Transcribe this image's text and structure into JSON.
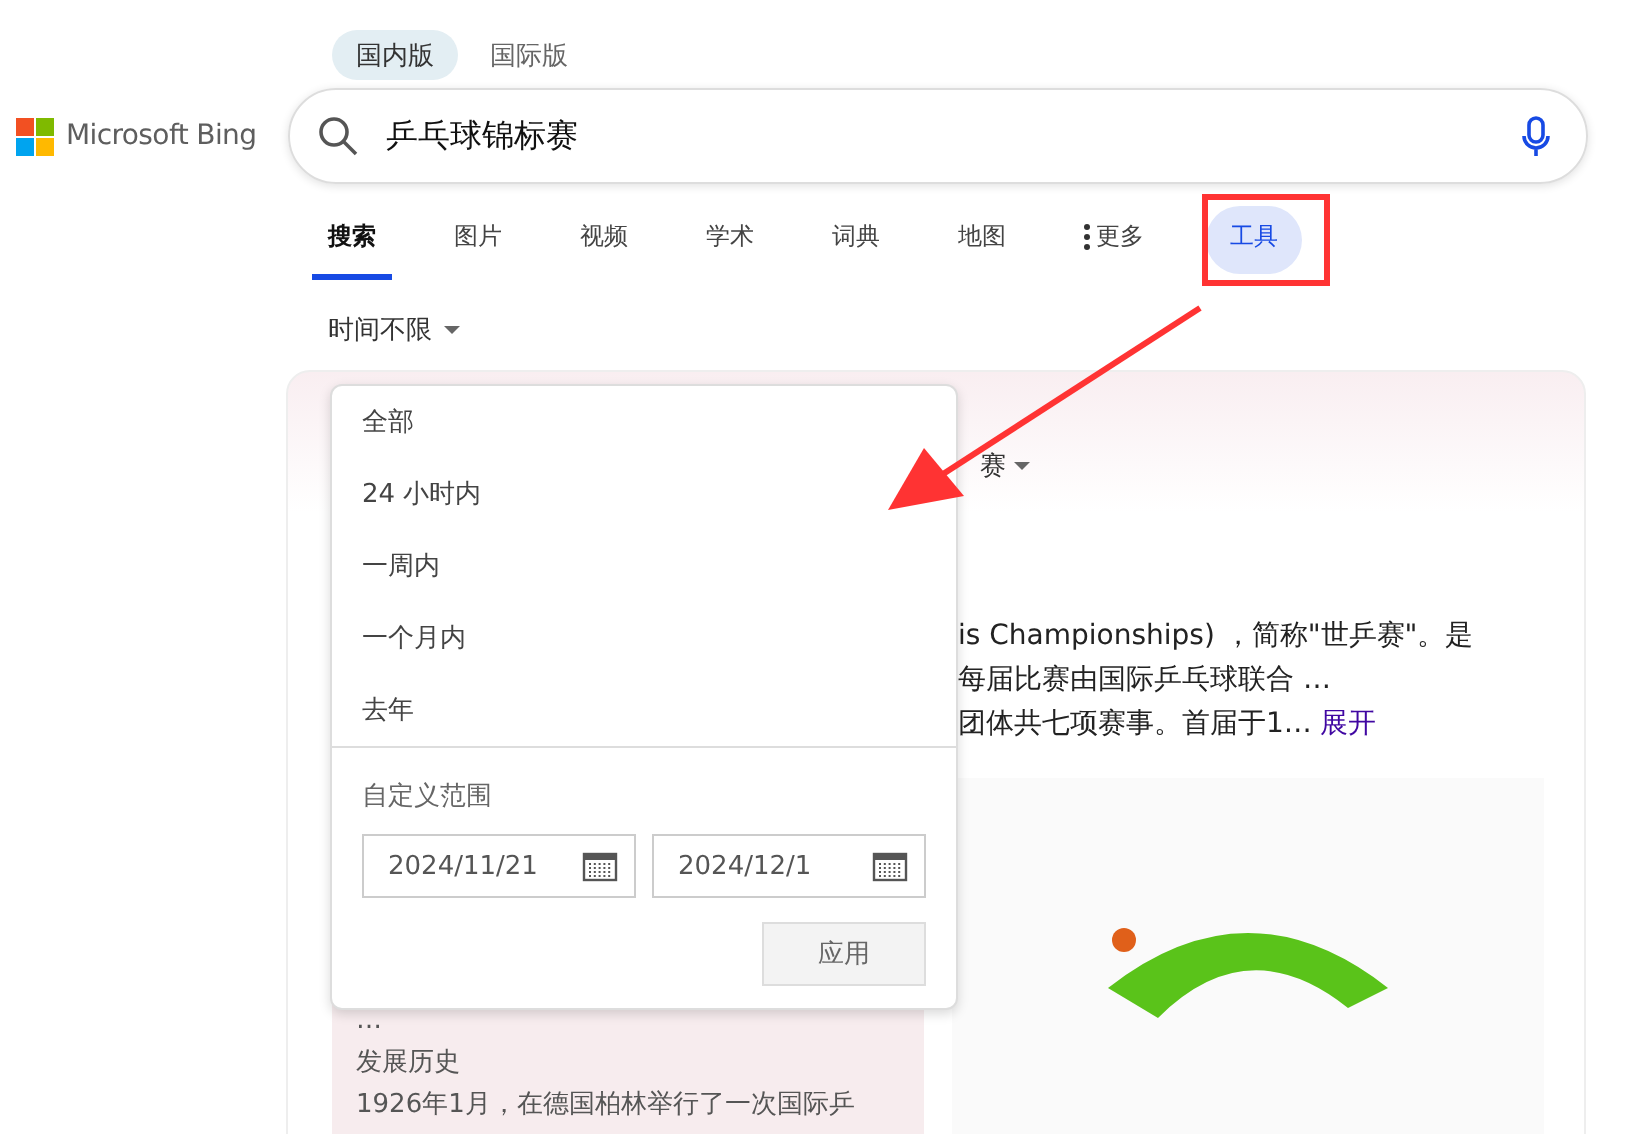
{
  "region_tabs": [
    {
      "label": "国内版",
      "selected": true
    },
    {
      "label": "国际版",
      "selected": false
    }
  ],
  "logo": {
    "text": "Microsoft Bing"
  },
  "search": {
    "value": "乒乓球锦标赛"
  },
  "nav_tabs": [
    {
      "kind": "tab",
      "label": "搜索",
      "selected": true,
      "highlighted": false
    },
    {
      "kind": "tab",
      "label": "图片",
      "selected": false,
      "highlighted": false
    },
    {
      "kind": "tab",
      "label": "视频",
      "selected": false,
      "highlighted": false
    },
    {
      "kind": "tab",
      "label": "学术",
      "selected": false,
      "highlighted": false
    },
    {
      "kind": "tab",
      "label": "词典",
      "selected": false,
      "highlighted": false
    },
    {
      "kind": "tab",
      "label": "地图",
      "selected": false,
      "highlighted": false
    },
    {
      "kind": "more",
      "label": "更多",
      "selected": false,
      "highlighted": false
    },
    {
      "kind": "tab",
      "label": "工具",
      "selected": false,
      "highlighted": true
    }
  ],
  "time_filter": {
    "label": "时间不限"
  },
  "time_menu": {
    "options": [
      "全部",
      "24 小时内",
      "一周内",
      "一个月内",
      "去年"
    ],
    "custom_label": "自定义范围",
    "start_date": "2024/11/21",
    "end_date": "2024/12/1",
    "apply_button": "应用"
  },
  "result": {
    "heading_fragment": "赛",
    "lines": [
      {
        "text": "is Championships) ，简称\"世乒赛\"。是"
      },
      {
        "text": "每届比赛由国际乒乓球联合 …"
      },
      {
        "text": "团体共七项赛事。首届于1…",
        "link": "展开"
      }
    ],
    "side_panel": [
      "…",
      "发展历史",
      "1926年1月，在德国柏林举行了一次国际乒"
    ]
  }
}
